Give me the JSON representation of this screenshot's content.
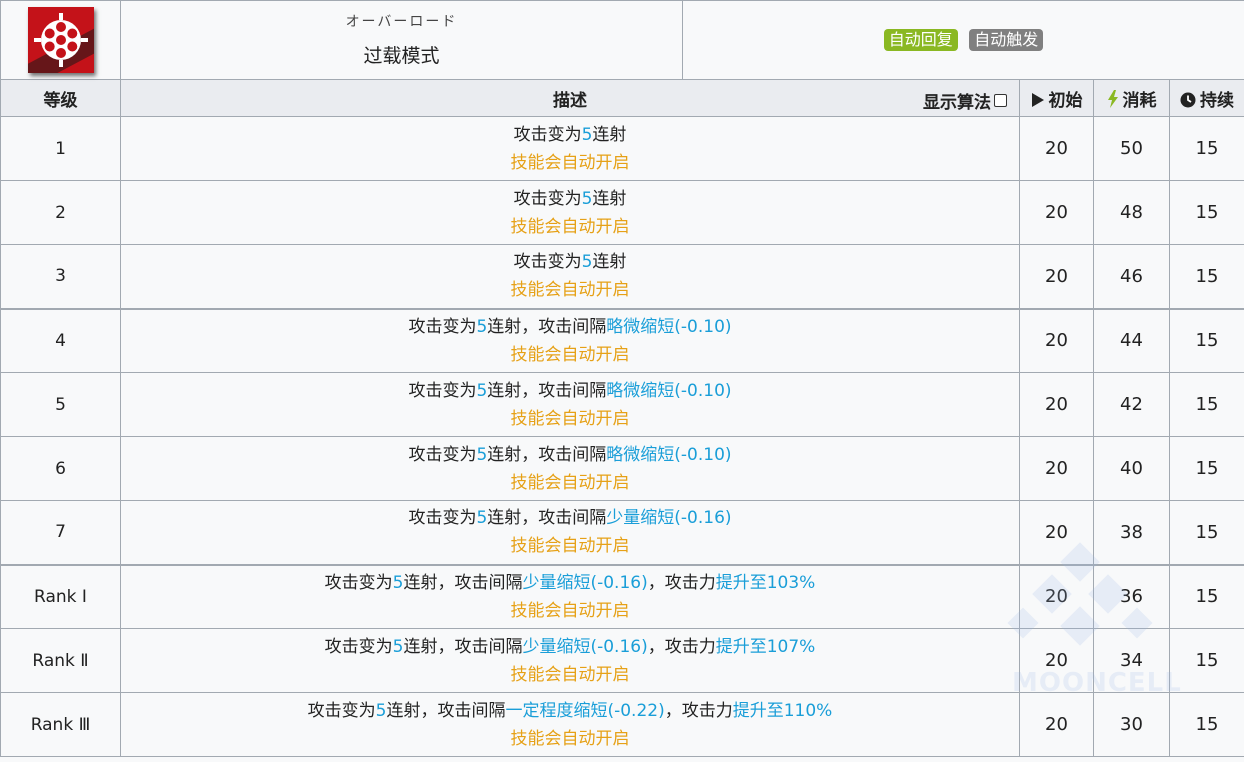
{
  "skill": {
    "icon": "revolver-cylinder-icon",
    "name_jp": "オーバーロード",
    "name_cn": "过载模式",
    "tags": [
      {
        "label": "自动回复",
        "color": "#8ab822"
      },
      {
        "label": "自动触发",
        "color": "#808080"
      }
    ]
  },
  "columns": {
    "level": "等级",
    "desc": "描述",
    "algo_toggle": "显示算法",
    "initial": "初始",
    "cost": "消耗",
    "duration": "持续"
  },
  "colors": {
    "highlight": "#1a9ed8",
    "auto_text": "#e6a117",
    "border": "#a2a9b1",
    "header_bg": "#eaecf0"
  },
  "rows": [
    {
      "level": "1",
      "desc": [
        {
          "t": "攻击变为"
        },
        {
          "t": "5",
          "h": 1
        },
        {
          "t": "连射"
        }
      ],
      "note": "技能会自动开启",
      "initial": "20",
      "cost": "50",
      "duration": "15"
    },
    {
      "level": "2",
      "desc": [
        {
          "t": "攻击变为"
        },
        {
          "t": "5",
          "h": 1
        },
        {
          "t": "连射"
        }
      ],
      "note": "技能会自动开启",
      "initial": "20",
      "cost": "48",
      "duration": "15"
    },
    {
      "level": "3",
      "desc": [
        {
          "t": "攻击变为"
        },
        {
          "t": "5",
          "h": 1
        },
        {
          "t": "连射"
        }
      ],
      "note": "技能会自动开启",
      "initial": "20",
      "cost": "46",
      "duration": "15"
    },
    {
      "level": "4",
      "desc": [
        {
          "t": "攻击变为"
        },
        {
          "t": "5",
          "h": 1
        },
        {
          "t": "连射，攻击间隔"
        },
        {
          "t": "略微缩短(-0.10)",
          "h": 1
        }
      ],
      "note": "技能会自动开启",
      "initial": "20",
      "cost": "44",
      "duration": "15"
    },
    {
      "level": "5",
      "desc": [
        {
          "t": "攻击变为"
        },
        {
          "t": "5",
          "h": 1
        },
        {
          "t": "连射，攻击间隔"
        },
        {
          "t": "略微缩短(-0.10)",
          "h": 1
        }
      ],
      "note": "技能会自动开启",
      "initial": "20",
      "cost": "42",
      "duration": "15"
    },
    {
      "level": "6",
      "desc": [
        {
          "t": "攻击变为"
        },
        {
          "t": "5",
          "h": 1
        },
        {
          "t": "连射，攻击间隔"
        },
        {
          "t": "略微缩短(-0.10)",
          "h": 1
        }
      ],
      "note": "技能会自动开启",
      "initial": "20",
      "cost": "40",
      "duration": "15"
    },
    {
      "level": "7",
      "desc": [
        {
          "t": "攻击变为"
        },
        {
          "t": "5",
          "h": 1
        },
        {
          "t": "连射，攻击间隔"
        },
        {
          "t": "少量缩短(-0.16)",
          "h": 1
        }
      ],
      "note": "技能会自动开启",
      "initial": "20",
      "cost": "38",
      "duration": "15"
    },
    {
      "level": "Rank Ⅰ",
      "desc": [
        {
          "t": "攻击变为"
        },
        {
          "t": "5",
          "h": 1
        },
        {
          "t": "连射，攻击间隔"
        },
        {
          "t": "少量缩短(-0.16)",
          "h": 1
        },
        {
          "t": "，攻击力"
        },
        {
          "t": "提升至103%",
          "h": 1
        }
      ],
      "note": "技能会自动开启",
      "initial": "20",
      "cost": "36",
      "duration": "15"
    },
    {
      "level": "Rank Ⅱ",
      "desc": [
        {
          "t": "攻击变为"
        },
        {
          "t": "5",
          "h": 1
        },
        {
          "t": "连射，攻击间隔"
        },
        {
          "t": "少量缩短(-0.16)",
          "h": 1
        },
        {
          "t": "，攻击力"
        },
        {
          "t": "提升至107%",
          "h": 1
        }
      ],
      "note": "技能会自动开启",
      "initial": "20",
      "cost": "34",
      "duration": "15"
    },
    {
      "level": "Rank Ⅲ",
      "desc": [
        {
          "t": "攻击变为"
        },
        {
          "t": "5",
          "h": 1
        },
        {
          "t": "连射，攻击间隔"
        },
        {
          "t": "一定程度缩短(-0.22)",
          "h": 1
        },
        {
          "t": "，攻击力"
        },
        {
          "t": "提升至110%",
          "h": 1
        }
      ],
      "note": "技能会自动开启",
      "initial": "20",
      "cost": "30",
      "duration": "15"
    }
  ],
  "watermark": "MOONCELL"
}
